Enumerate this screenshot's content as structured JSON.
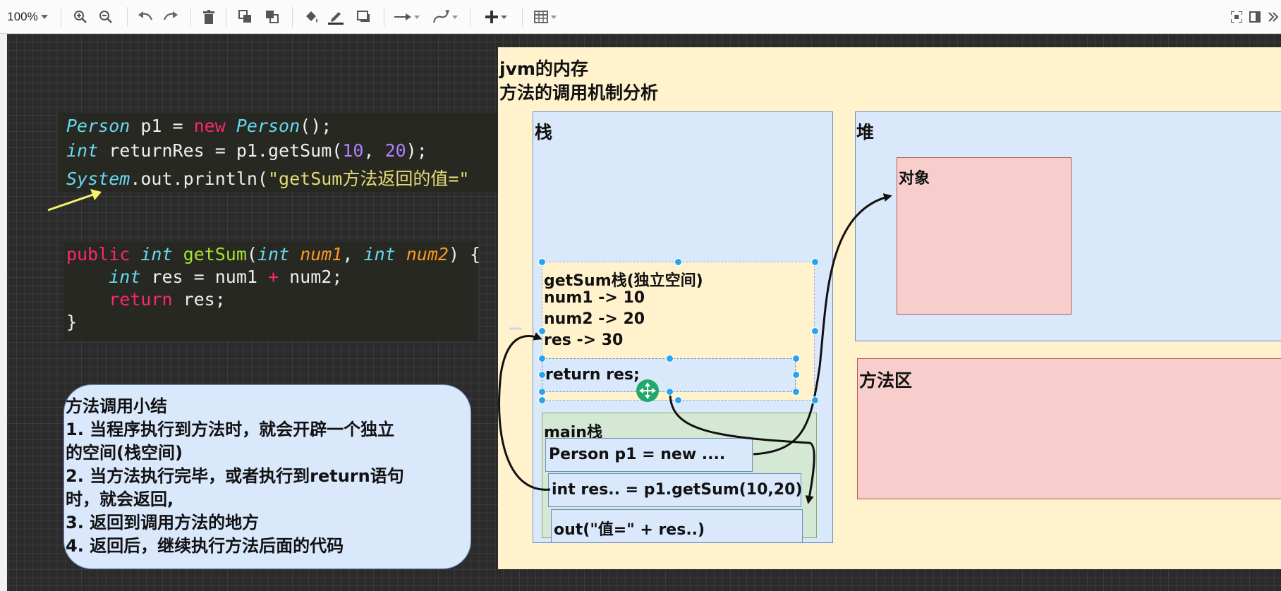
{
  "toolbar": {
    "zoom": "100%",
    "icons": [
      "zoom-in-icon",
      "zoom-out-icon",
      "undo-icon",
      "redo-icon",
      "delete-icon",
      "to-front-icon",
      "to-back-icon",
      "fill-color-icon",
      "line-color-icon",
      "shadow-icon",
      "connection-icon",
      "waypoints-icon",
      "insert-icon",
      "table-icon",
      "fullscreen-icon",
      "format-panel-icon",
      "collapse-icon"
    ]
  },
  "code_call": {
    "line1": {
      "a": "Person",
      "b": " p1 = ",
      "c": "new",
      "d": " ",
      "e": "Person",
      "f": "();"
    },
    "line2": {
      "a": "int",
      "b": " returnRes = p1.getSum(",
      "c": "10",
      "d": ", ",
      "e": "20",
      "f": ");"
    },
    "line3": {
      "a": "System",
      "b": ".out.println(",
      "c": "\"getSum方法返回的值=\""
    }
  },
  "code_method": {
    "line1": {
      "a": "public",
      "b": " ",
      "c": "int",
      "d": " ",
      "e": "getSum",
      "f": "(",
      "g": "int",
      "h": " ",
      "i": "num1",
      "j": ", ",
      "k": "int",
      "l": " ",
      "m": "num2",
      "n": ") {"
    },
    "line2": {
      "a": "    ",
      "b": "int",
      "c": " res = num1 ",
      "d": "+",
      "e": " num2;"
    },
    "line3": {
      "a": "    ",
      "b": "return",
      "c": " res;"
    },
    "line4": "}"
  },
  "summary": {
    "title": "方法调用小结",
    "lines": [
      "1. 当程序执行到方法时，就会开辟一个独立",
      "的空间(栈空间)",
      "2. 当方法执行完毕，或者执行到return语句",
      "时，就会返回,",
      "3. 返回到调用方法的地方",
      "4. 返回后，继续执行方法后面的代码"
    ]
  },
  "diagram": {
    "title_line1": "jvm的内存",
    "title_line2": "方法的调用机制分析",
    "stack_label": "栈",
    "heap_label": "堆",
    "object_label": "对象",
    "method_area_label": "方法区",
    "getsum_frame": {
      "title": "getSum栈(独立空间)",
      "vars": [
        "num1 -> 10",
        "num2 -> 20",
        "res -> 30"
      ],
      "return_stmt": "return res;"
    },
    "main_frame": {
      "title": "main栈",
      "rows": [
        "Person p1 = new ....",
        "int res.. = p1.getSum(10,20)",
        "out(\"值=\" + res..)"
      ]
    },
    "colors": {
      "panel": "#fff2cc",
      "blue_box": "#dae8fc",
      "red_box": "#f8cecc",
      "green_box": "#d5e8d4",
      "selection": "#29a3f0",
      "pointer": "#f5f26b"
    }
  }
}
